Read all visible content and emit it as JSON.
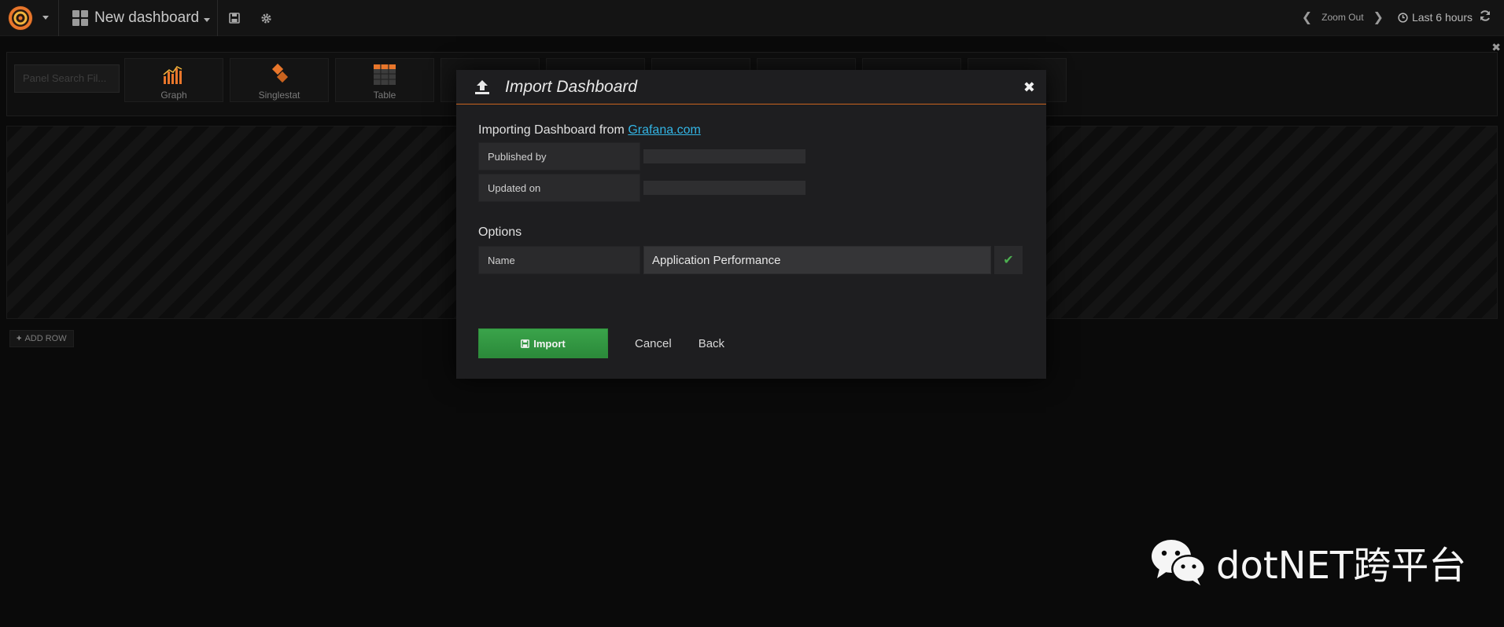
{
  "navbar": {
    "dashboard_title": "New dashboard",
    "zoom_out": "Zoom Out",
    "time_range": "Last 6 hours"
  },
  "panel_picker": {
    "search_placeholder": "Panel Search Fil...",
    "items": [
      {
        "label": "Graph",
        "icon": "graph-panel-icon"
      },
      {
        "label": "Singlestat",
        "icon": "singlestat-panel-icon"
      },
      {
        "label": "Table",
        "icon": "table-panel-icon"
      }
    ]
  },
  "rows": {
    "add_row_label": "ADD ROW"
  },
  "modal": {
    "title": "Import Dashboard",
    "importing_prefix": "Importing Dashboard from ",
    "importing_link": "Grafana.com",
    "published_by_label": "Published by",
    "published_by_value": "",
    "updated_on_label": "Updated on",
    "updated_on_value": "",
    "options_heading": "Options",
    "name_label": "Name",
    "name_value": "Application Performance",
    "import_button": "Import",
    "cancel_button": "Cancel",
    "back_button": "Back"
  },
  "watermark": {
    "text": "dotNET跨平台"
  },
  "colors": {
    "accent_orange": "#c9631f",
    "import_green": "#33a046",
    "link_blue": "#33b5e5",
    "check_green": "#4caf50"
  }
}
